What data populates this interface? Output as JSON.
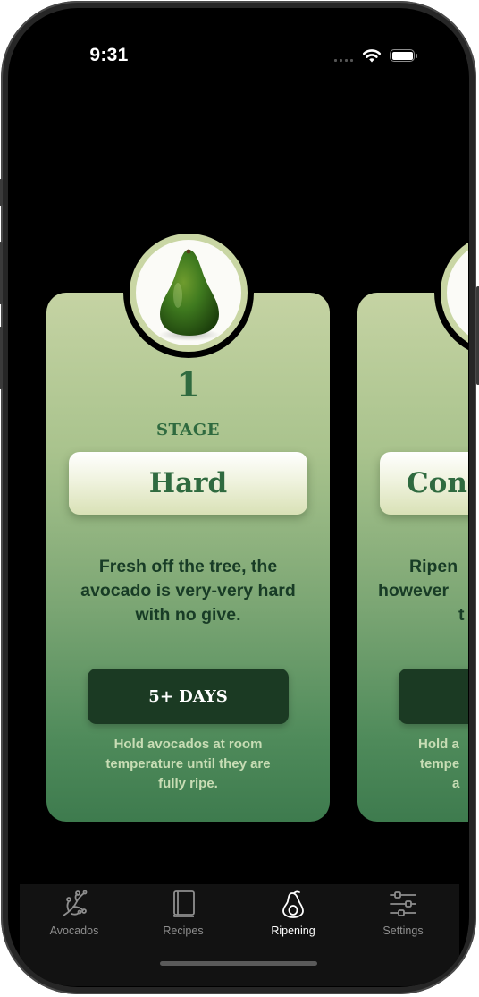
{
  "status_bar": {
    "time": "9:31",
    "icons": [
      "signal-icon",
      "wifi-icon",
      "battery-icon"
    ]
  },
  "cards": [
    {
      "stage_number": "1",
      "stage_label": "STAGE",
      "name": "Hard",
      "description": "Fresh off the tree, the avocado is very-very hard with no give.",
      "days": "5+ DAYS",
      "hint": "Hold avocados at room temperature until they are fully ripe."
    },
    {
      "name": "Con",
      "description_lines": [
        "Ripen",
        "however",
        "t"
      ],
      "hint_lines": [
        "Hold a",
        "tempe",
        "a"
      ]
    }
  ],
  "tabs": [
    {
      "label": "Avocados",
      "icon": "branch-icon",
      "active": false
    },
    {
      "label": "Recipes",
      "icon": "book-icon",
      "active": false
    },
    {
      "label": "Ripening",
      "icon": "avocado-icon",
      "active": true
    },
    {
      "label": "Settings",
      "icon": "sliders-icon",
      "active": false
    }
  ],
  "colors": {
    "primary_green": "#2f6a3f",
    "dark_green": "#1b3a23",
    "card_top": "#c5d3a3",
    "card_bottom": "#3e7b4e"
  }
}
